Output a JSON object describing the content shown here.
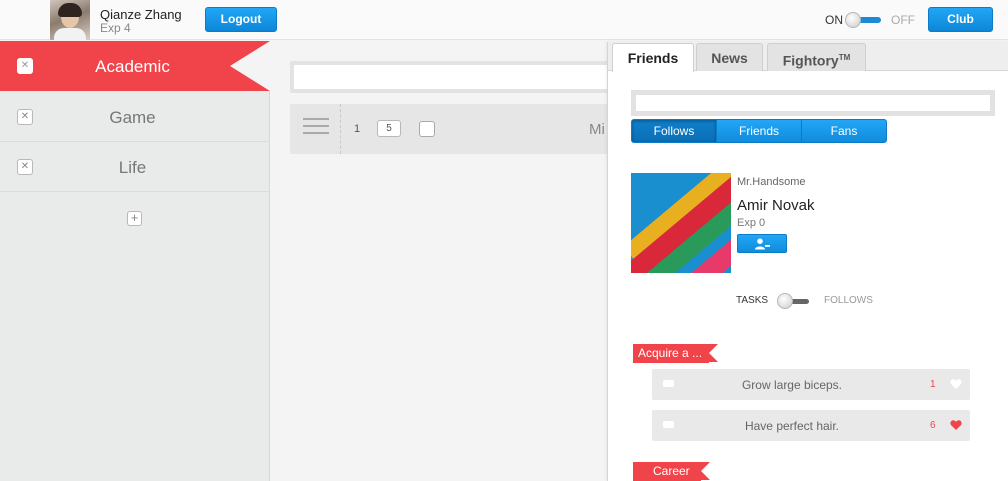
{
  "topbar": {
    "user_name": "Qianze Zhang",
    "user_exp": "Exp 4",
    "logout_label": "Logout",
    "toggle_on_label": "ON",
    "toggle_off_label": "OFF",
    "club_label": "Club"
  },
  "sidebar": {
    "categories": [
      {
        "label": "Academic",
        "active": true
      },
      {
        "label": "Game",
        "active": false
      },
      {
        "label": "Life",
        "active": false
      }
    ],
    "close_glyph": "✕",
    "add_glyph": "+"
  },
  "main": {
    "task_row": {
      "number": "1",
      "badge": "5",
      "title_visible": "Mi"
    }
  },
  "friends_panel": {
    "tabs": [
      {
        "label": "Friends",
        "active": true
      },
      {
        "label": "News",
        "active": false
      },
      {
        "label": "Fightory",
        "sup": "TM",
        "active": false
      }
    ],
    "segments": [
      {
        "label": "Follows",
        "active": true
      },
      {
        "label": "Friends",
        "active": false
      },
      {
        "label": "Fans",
        "active": false
      }
    ],
    "profile": {
      "nickname": "Mr.Handsome",
      "name": "Amir Novak",
      "exp": "Exp 0"
    },
    "view_toggle": {
      "left_label": "TASKS",
      "right_label": "FOLLOWS"
    },
    "groups": [
      {
        "label": "Acquire a ...",
        "tasks": [
          {
            "title": "Grow large biceps.",
            "count": "1",
            "liked": false
          },
          {
            "title": "Have perfect hair.",
            "count": "6",
            "liked": true
          }
        ]
      },
      {
        "label": "Career",
        "tasks": []
      }
    ],
    "colors": {
      "heart_liked": "#f0444a",
      "heart_unliked": "#ffffff"
    }
  }
}
